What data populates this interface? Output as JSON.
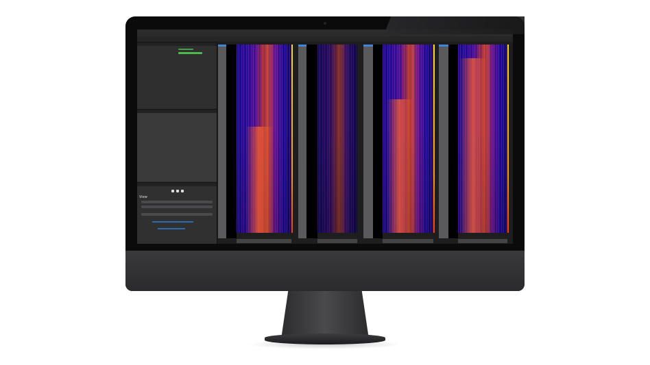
{
  "device": "desktop-monitor",
  "app": {
    "left_pane": {
      "view_section_label": "View"
    },
    "spectrogram_panels": 4,
    "colors": {
      "accent": "#3f86d8",
      "spectrogram_low": "#1010a0",
      "spectrogram_high": "#f0582a",
      "level_bar": "#ffe100"
    }
  }
}
